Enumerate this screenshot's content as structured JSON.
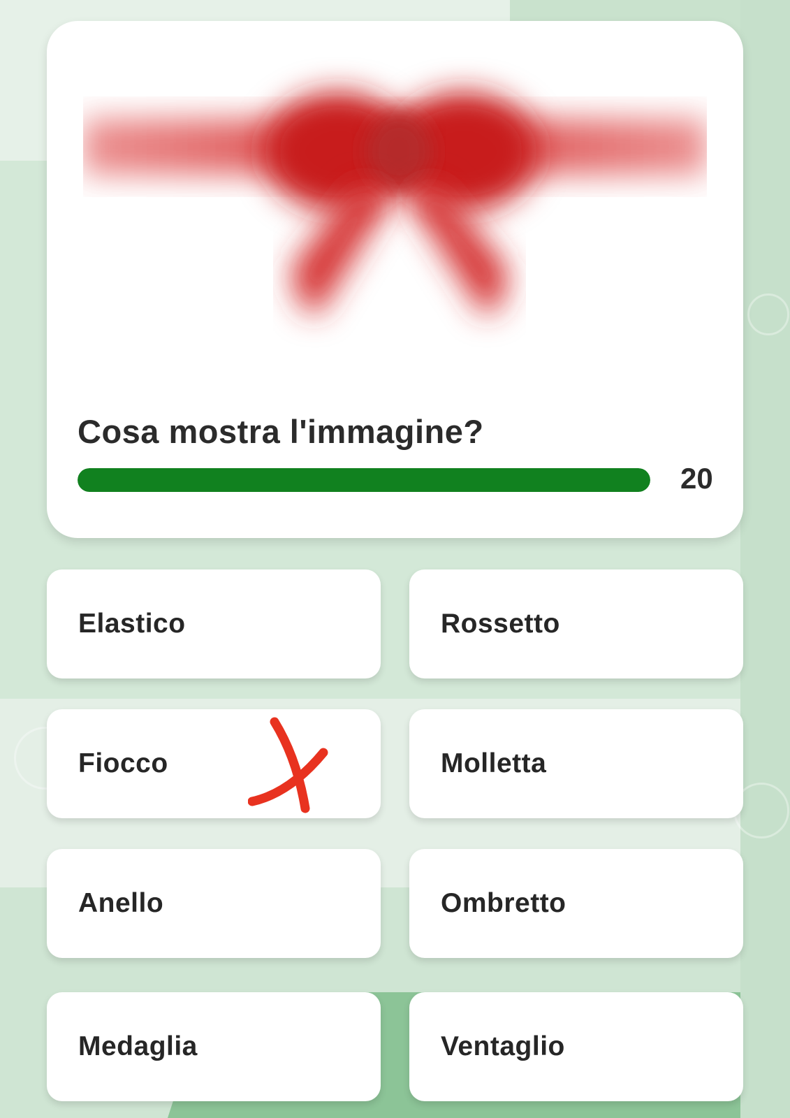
{
  "question": {
    "text": "Cosa mostra l'immagine?",
    "image_icon": "blurred-red-bow-image"
  },
  "timer": {
    "count": "20",
    "progress_percent": 100,
    "color": "#11811f"
  },
  "answers": [
    {
      "label": "Elastico"
    },
    {
      "label": "Rossetto"
    },
    {
      "label": "Fiocco",
      "mark": "red-x-scribble-icon"
    },
    {
      "label": "Molletta"
    },
    {
      "label": "Anello"
    },
    {
      "label": "Ombretto"
    },
    {
      "label": "Medaglia"
    },
    {
      "label": "Ventaglio"
    }
  ],
  "colors": {
    "accent": "#11811f",
    "mark": "#e8321f",
    "bow": "#c81e1e"
  }
}
